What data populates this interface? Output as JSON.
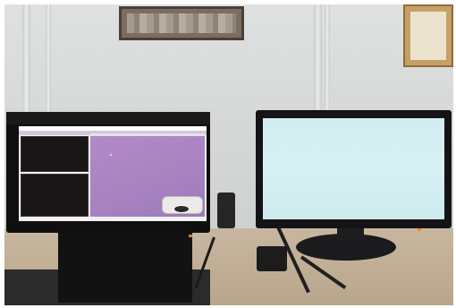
{
  "scene": {
    "description_text": "",
    "colors": {
      "wall": "#d6d8d8",
      "desk": "#b8a68c",
      "monitor_bezel": "#141416",
      "left_screen_panel": "#a782c0",
      "right_screen": "#d2eef2",
      "power_led": "#ff8a00"
    }
  }
}
